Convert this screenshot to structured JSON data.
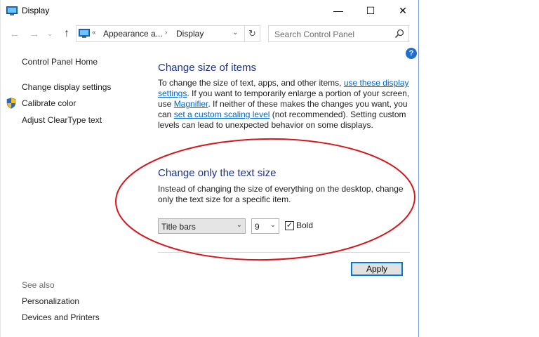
{
  "window": {
    "title": "Display",
    "minimize": "—",
    "maximize": "☐",
    "close": "✕"
  },
  "nav": {
    "back": "←",
    "forward": "→",
    "recent": "⌄",
    "up": "↑",
    "address_overflow": "«",
    "breadcrumb1": "Appearance a...",
    "breadcrumb_sep": "›",
    "breadcrumb2": "Display",
    "address_dropdown": "⌄",
    "refresh": "↻",
    "search_placeholder": "Search Control Panel"
  },
  "help_label": "?",
  "sidebar": {
    "home": "Control Panel Home",
    "change_display": "Change display settings",
    "calibrate": "Calibrate color",
    "cleartype": "Adjust ClearType text",
    "see_also": "See also",
    "personalization": "Personalization",
    "devices": "Devices and Printers"
  },
  "section1": {
    "heading": "Change size of items",
    "t1": "To change the size of text, apps, and other items, ",
    "link1": "use these display settings",
    "t2": ". If you want to temporarily enlarge a portion of your screen, use ",
    "link2": "Magnifier",
    "t3": ". If neither of these makes the changes you want, you can ",
    "link3": "set a custom scaling level",
    "t4": " (not recommended). Setting custom levels can lead to unexpected behavior on some displays."
  },
  "section2": {
    "heading": "Change only the text size",
    "description": "Instead of changing the size of everything on the desktop, change only the text size for a specific item.",
    "item_select": "Title bars",
    "size_select": "9",
    "bold_label": "Bold",
    "bold_checked": "✓"
  },
  "apply_label": "Apply",
  "colors": {
    "heading": "#1e3287",
    "link": "#0066cc",
    "annotation": "#d9141a",
    "accent": "#0078d7"
  },
  "icons": {
    "title": "monitor-icon",
    "address": "monitor-icon",
    "search": "search-icon",
    "shield": "shield-icon",
    "help": "help-icon"
  }
}
